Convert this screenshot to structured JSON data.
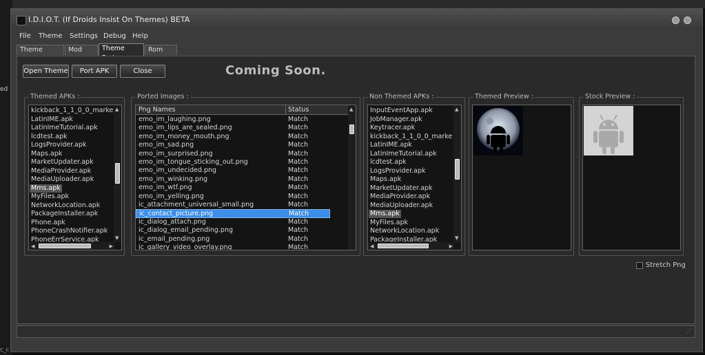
{
  "window": {
    "title": "I.D.I.O.T. (If Droids Insist On Themes) BETA"
  },
  "menu": [
    "File",
    "Theme",
    "Settings",
    "Debug",
    "Help"
  ],
  "tabs": [
    "Theme Builder",
    "Mod Utils",
    "Theme Porter",
    "Rom Chef"
  ],
  "active_tab": "Theme Porter",
  "toolbar": {
    "open_theme": "Open Theme",
    "port_apk": "Port APK",
    "close": "Close",
    "coming_soon": "Coming Soon."
  },
  "themed_apks": {
    "label": "Themed APKs :",
    "items": [
      "kickback_1_1_0_0_marke",
      "LatinIME.apk",
      "LatinImeTutorial.apk",
      "lcdtest.apk",
      "LogsProvider.apk",
      "Maps.apk",
      "MarketUpdater.apk",
      "MediaProvider.apk",
      "MediaUploader.apk",
      "Mms.apk",
      "MyFiles.apk",
      "NetworkLocation.apk",
      "PackageInstaller.apk",
      "Phone.apk",
      "PhoneCrashNotifier.apk",
      "PhoneErrService.apk"
    ],
    "selected": "Mms.apk"
  },
  "ported_images": {
    "label": "Ported Images :",
    "columns": [
      "Png Names",
      "Status"
    ],
    "rows": [
      [
        "emo_im_laughing.png",
        "Match"
      ],
      [
        "emo_im_lips_are_sealed.png",
        "Match"
      ],
      [
        "emo_im_money_mouth.png",
        "Match"
      ],
      [
        "emo_im_sad.png",
        "Match"
      ],
      [
        "emo_im_surprised.png",
        "Match"
      ],
      [
        "emo_im_tongue_sticking_out.png",
        "Match"
      ],
      [
        "emo_im_undecided.png",
        "Match"
      ],
      [
        "emo_im_winking.png",
        "Match"
      ],
      [
        "emo_im_wtf.png",
        "Match"
      ],
      [
        "emo_im_yelling.png",
        "Match"
      ],
      [
        "ic_attachment_universal_small.png",
        "Match"
      ],
      [
        "ic_contact_picture.png",
        "Match"
      ],
      [
        "ic_dialog_attach.png",
        "Match"
      ],
      [
        "ic_dialog_email_pending.png",
        "Match"
      ],
      [
        "ic_email_pending.png",
        "Match"
      ],
      [
        "ic_gallery_video_overlay.png",
        "Match"
      ]
    ],
    "selected": "ic_contact_picture.png"
  },
  "non_themed_apks": {
    "label": "Non Themed APKs :",
    "items": [
      "InputEventApp.apk",
      "JobManager.apk",
      "Keytracer.apk",
      "kickback_1_1_0_0_marke",
      "LatinIME.apk",
      "LatinImeTutorial.apk",
      "lcdtest.apk",
      "LogsProvider.apk",
      "Maps.apk",
      "MarketUpdater.apk",
      "MediaProvider.apk",
      "MediaUploader.apk",
      "Mms.apk",
      "MyFiles.apk",
      "NetworkLocation.apk",
      "PackageInstaller.apk"
    ],
    "selected": "Mms.apk"
  },
  "themed_preview": {
    "label": "Themed Preview :"
  },
  "stock_preview": {
    "label": "Stock Preview :"
  },
  "options": {
    "stretch_png": "Stretch Png"
  },
  "desktop": {
    "bottom_text": "C_li"
  },
  "colors": {
    "selection": "#3d8ee8",
    "background": "#2a2a2a"
  }
}
